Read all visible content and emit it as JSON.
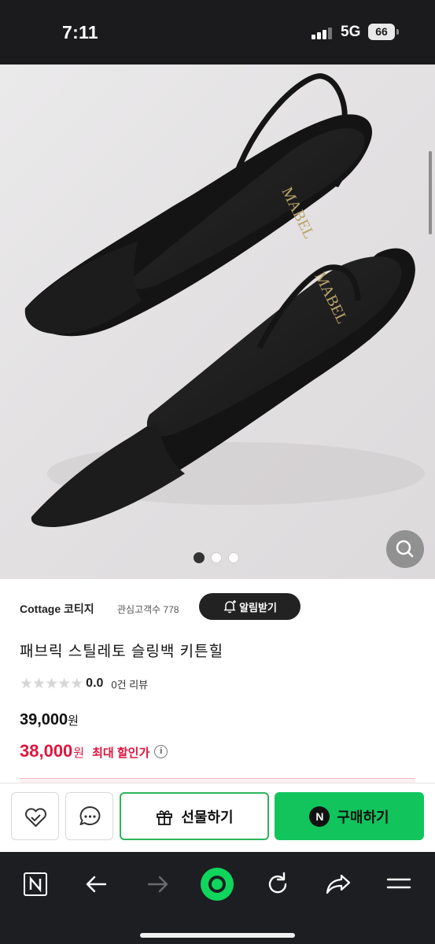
{
  "status_bar": {
    "time": "7:11",
    "network": "5G",
    "battery": "66"
  },
  "product_image": {
    "brand_print": "MABEL",
    "carousel": {
      "total": 3,
      "active": 1
    },
    "zoom_icon": "search-icon"
  },
  "seller": {
    "name": "Cottage 코티지",
    "favorites_text": "관심고객수 778",
    "alarm_button": "알림받기",
    "alarm_icon": "bell-plus-icon"
  },
  "product": {
    "title": "패브릭 스틸레토 슬링백 키튼힐",
    "rating_stars": "★★★★★",
    "rating": "0.0",
    "review_text": "0건 리뷰",
    "price": "39,000",
    "price_unit": "원",
    "sale_price": "38,000",
    "sale_unit": "원",
    "sale_label": "최대 할인가",
    "info_icon": "i"
  },
  "buy_bar": {
    "wishlist_icon": "heart-check-icon",
    "chat_icon": "chat-icon",
    "gift_label": "선물하기",
    "gift_icon": "gift-icon",
    "buy_label": "구매하기",
    "buy_badge": "N"
  },
  "browser_nav": {
    "items": [
      "naver-home-icon",
      "back-arrow-icon",
      "forward-arrow-icon",
      "green-dot-icon",
      "refresh-icon",
      "share-icon",
      "menu-icon"
    ]
  },
  "colors": {
    "accent_green": "#11c45c",
    "sale_red": "#e0143d",
    "status_bar": "#1b1b1d",
    "nav_bar": "#1d1e22"
  }
}
